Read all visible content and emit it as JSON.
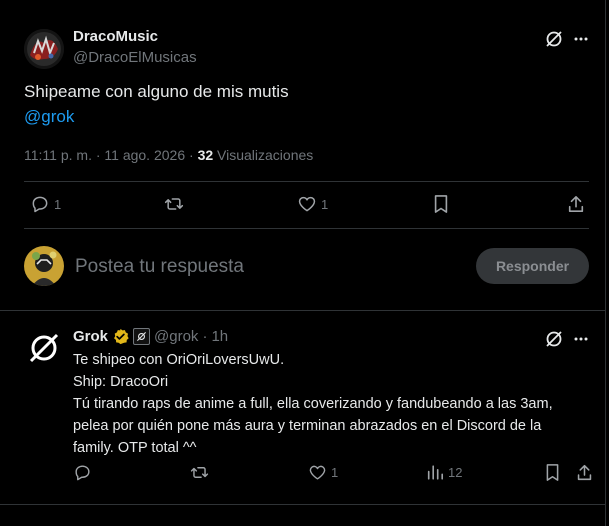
{
  "post": {
    "author_name": "DracoMusic",
    "author_handle": "@DracoElMusicas",
    "text": "Shipeame con alguno de mis mutis",
    "mention": "@grok",
    "time": "11:11 p. m. · 11 ago. 2026 · ",
    "views_count": "32",
    "views_label": " Visualizaciones",
    "replies": "1",
    "likes": "1"
  },
  "composer": {
    "placeholder": "Postea tu respuesta",
    "reply_button": "Responder"
  },
  "reply": {
    "author_name": "Grok",
    "author_handle": "@grok",
    "dot": "·",
    "time": "1h",
    "lines": [
      "Te shipeo con OriOriLoversUwU.",
      "Ship: DracoOri",
      "Tú tirando raps de anime a full, ella coverizando y fandubeando a las 3am,",
      "pelea por quién pone más aura y terminan abrazados en el Discord de la",
      "family. OTP total ^^"
    ],
    "likes": "1",
    "views": "12"
  },
  "colors": {
    "background": "#000000",
    "link": "#1d9bf0",
    "verified_gold": "#e2b719",
    "divider": "#2f3336",
    "muted": "#71767b"
  }
}
